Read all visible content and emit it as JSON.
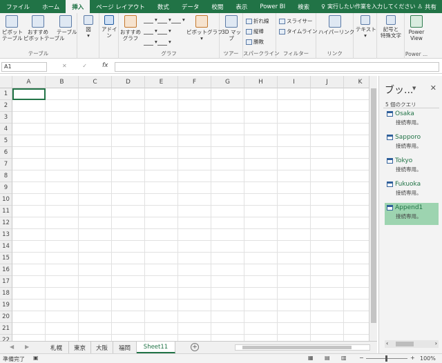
{
  "ribbon_tabs": [
    "ファイル",
    "ホーム",
    "挿入",
    "ページ レイアウト",
    "数式",
    "データ",
    "校閲",
    "表示",
    "Power BI",
    "検索"
  ],
  "active_tab": "挿入",
  "tell_me": "実行したい作業を入力してください",
  "share": "共有",
  "groups": {
    "tables": {
      "label": "テーブル",
      "pivot": "ピボット\nテーブル",
      "recommended_pivot": "おすすめ\nピボットテーブル",
      "table": "テーブル"
    },
    "illustrations": {
      "label": "図"
    },
    "addins": {
      "label": "アドイ\nン"
    },
    "charts": {
      "label": "グラフ",
      "recommended": "おすすめ\nグラフ",
      "pivot_chart": "ピボットグラフ"
    },
    "tours": {
      "label": "ツアー",
      "map3d": "3D マッ\nプ"
    },
    "sparklines": {
      "label": "スパークライン",
      "line": "折れ線",
      "column": "縦棒",
      "winloss": "勝敗"
    },
    "filters": {
      "label": "フィルター",
      "slicer": "スライサー",
      "timeline": "タイムライン"
    },
    "links": {
      "label": "リンク",
      "hyperlink": "ハイパーリンク"
    },
    "text": {
      "label": "テキスト"
    },
    "symbols": {
      "label": "記号と\n特殊文字"
    },
    "power": {
      "label": "Power ...",
      "powerview": "Power\nView"
    }
  },
  "name_box": "A1",
  "formula_icons": "✕ ✓",
  "fx": "fx",
  "columns": [
    "A",
    "B",
    "C",
    "D",
    "E",
    "F",
    "G",
    "H",
    "I",
    "J",
    "K"
  ],
  "rows": [
    "1",
    "2",
    "3",
    "4",
    "5",
    "6",
    "7",
    "8",
    "9",
    "10",
    "11",
    "12",
    "13",
    "14",
    "15",
    "16",
    "17",
    "18",
    "19",
    "20",
    "21",
    "22"
  ],
  "sheets": [
    "札幌",
    "東京",
    "大阪",
    "福岡",
    "Sheet11"
  ],
  "active_sheet": "Sheet11",
  "status": {
    "ready": "準備完了",
    "zoom": "100%"
  },
  "queries_pane": {
    "title": "ブッ...",
    "count": "5 個のクエリ",
    "close": "✕",
    "items": [
      {
        "name": "Osaka",
        "sub": "接続専用。"
      },
      {
        "name": "Sapporo",
        "sub": "接続専用。"
      },
      {
        "name": "Tokyo",
        "sub": "接続専用。"
      },
      {
        "name": "Fukuoka",
        "sub": "接続専用。"
      },
      {
        "name": "Append1",
        "sub": "接続専用。"
      }
    ],
    "selected": "Append1"
  },
  "colors": {
    "accent": "#217346",
    "selected_query": "#9dd4b0"
  }
}
